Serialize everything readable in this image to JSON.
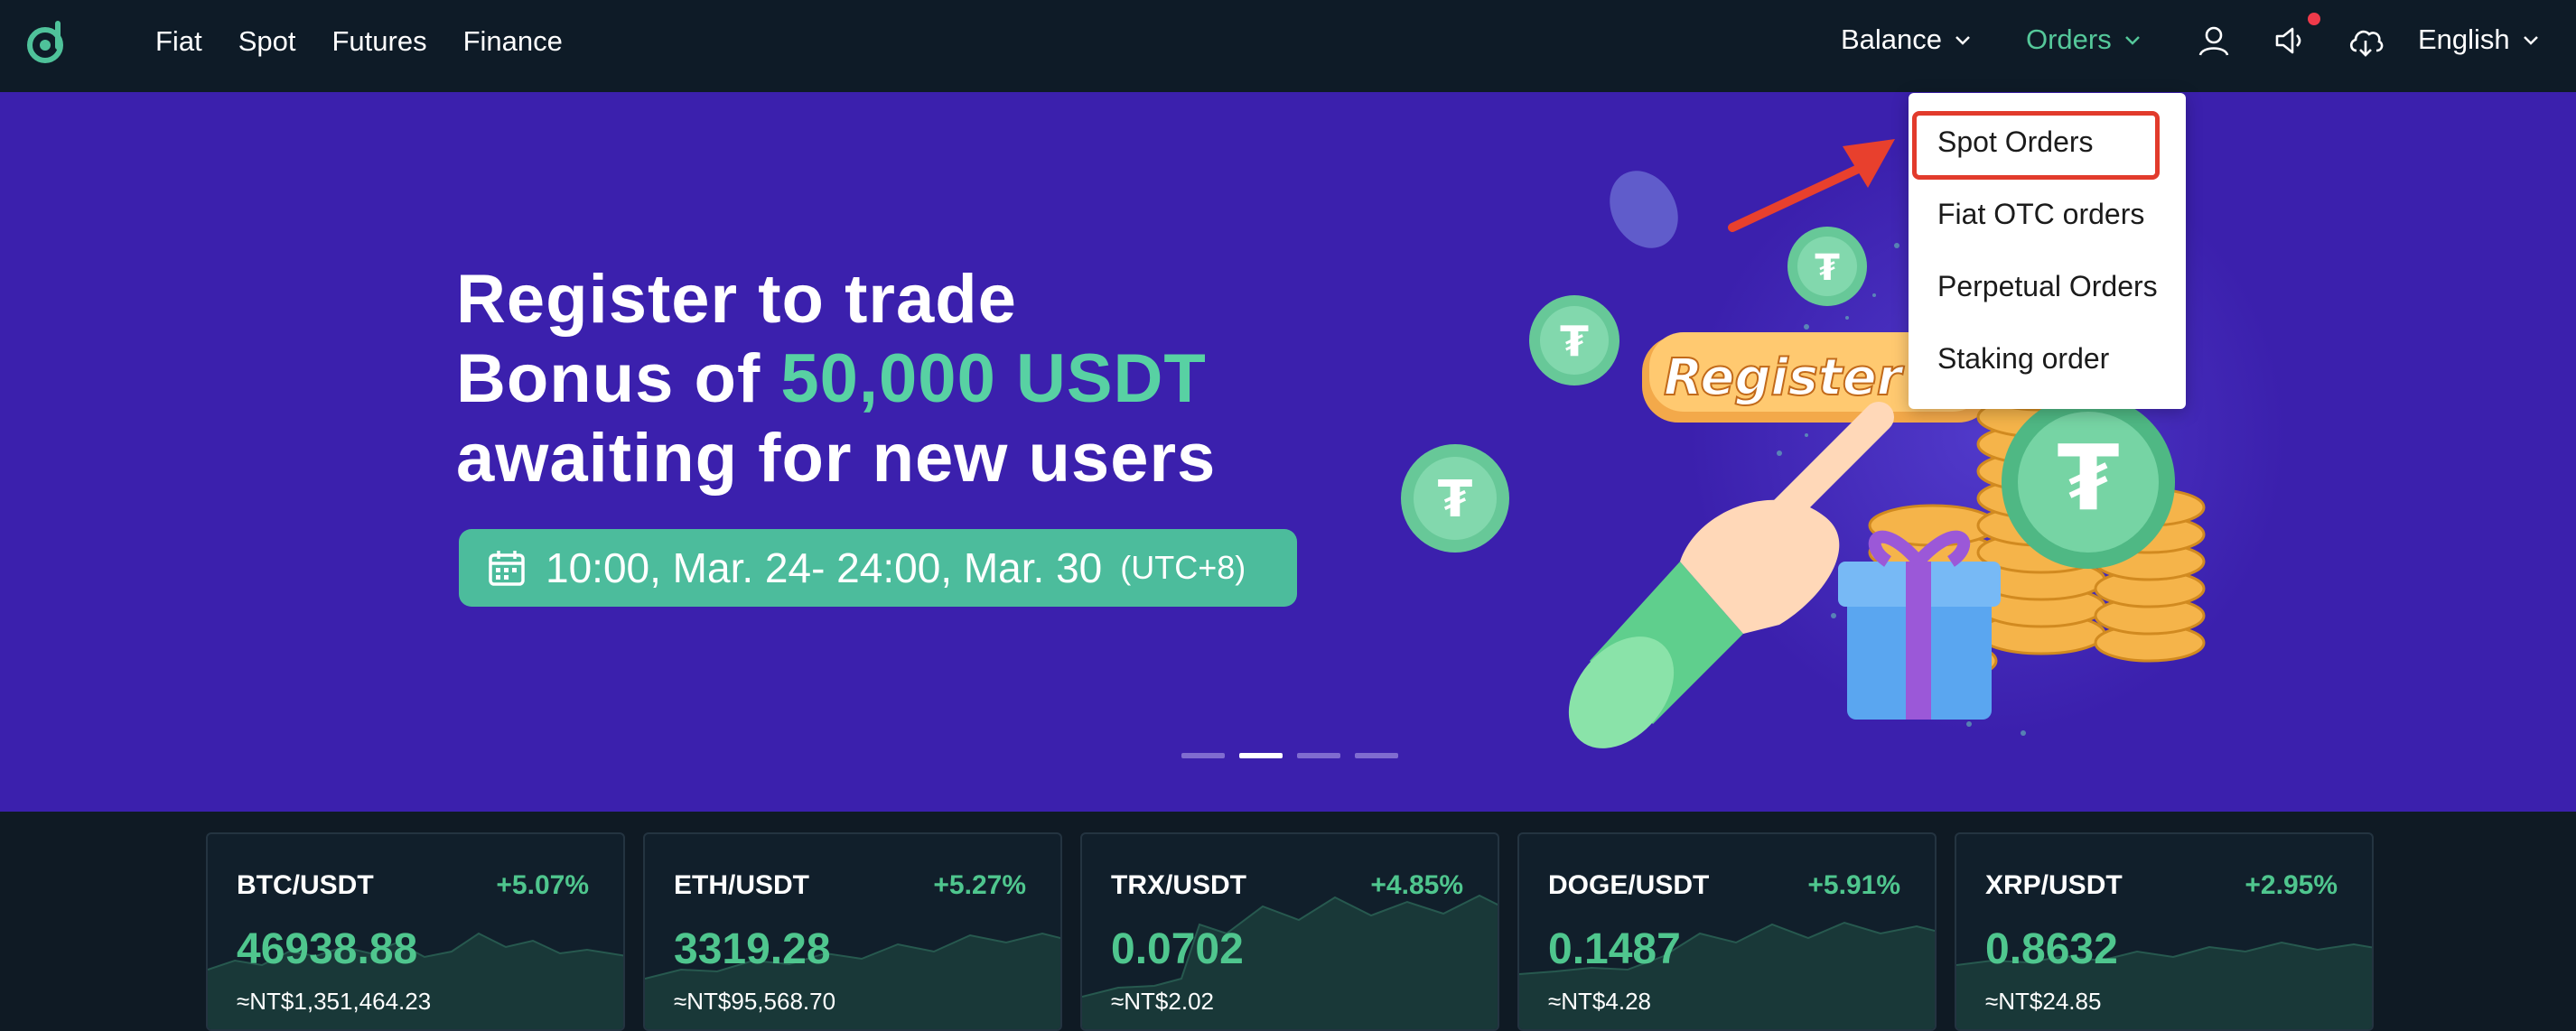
{
  "nav": {
    "links": [
      "Fiat",
      "Spot",
      "Futures",
      "Finance"
    ],
    "balance_label": "Balance",
    "orders_label": "Orders",
    "language_label": "English",
    "icons": [
      "logo-icon",
      "user-icon",
      "speaker-icon",
      "download-icon",
      "chevron-down-icon"
    ]
  },
  "orders_menu": {
    "items": [
      "Spot Orders",
      "Fiat OTC orders",
      "Perpetual Orders",
      "Staking order"
    ],
    "highlighted_index": 0
  },
  "hero": {
    "line1": "Register to trade",
    "line2_prefix": "Bonus of ",
    "line2_accent": "50,000 USDT",
    "line3": "awaiting for new users",
    "date_range": "10:00, Mar. 24- 24:00, Mar. 30",
    "timezone": "(UTC+8)",
    "register_badge": "Register Now",
    "carousel_total": 4,
    "carousel_active": 1
  },
  "tickers": [
    {
      "pair": "BTC/USDT",
      "change": "+5.07%",
      "price": "46938.88",
      "fiat": "≈NT$1,351,464.23"
    },
    {
      "pair": "ETH/USDT",
      "change": "+5.27%",
      "price": "3319.28",
      "fiat": "≈NT$95,568.70"
    },
    {
      "pair": "TRX/USDT",
      "change": "+4.85%",
      "price": "0.0702",
      "fiat": "≈NT$2.02"
    },
    {
      "pair": "DOGE/USDT",
      "change": "+5.91%",
      "price": "0.1487",
      "fiat": "≈NT$4.28"
    },
    {
      "pair": "XRP/USDT",
      "change": "+2.95%",
      "price": "0.8632",
      "fiat": "≈NT$24.85"
    }
  ],
  "colors": {
    "accent": "#55c89a",
    "nav_bg": "#0e1b27",
    "hero_bg": "#3b20ad",
    "positive": "#4fc68e",
    "highlight_box": "#e23b2c"
  }
}
